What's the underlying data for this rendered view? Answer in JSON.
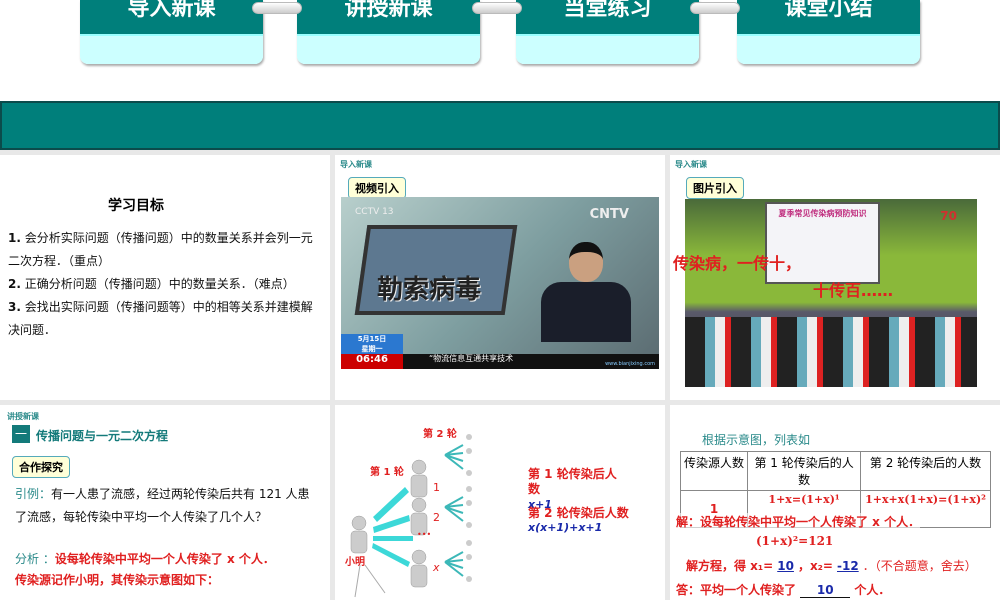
{
  "nav_tabs": [
    "导入新课",
    "讲授新课",
    "当堂练习",
    "课堂小结"
  ],
  "slide1": {
    "title": "学习目标",
    "items": [
      {
        "num": "1.",
        "text": "会分析实际问题（传播问题）中的数量关系并会列一元二次方程．（重点）"
      },
      {
        "num": "2.",
        "text": "正确分析问题（传播问题）中的数量关系．（难点）"
      },
      {
        "num": "3.",
        "text": "会找出实际问题（传播问题等）中的相等关系并建模解决问题．"
      }
    ]
  },
  "slide2": {
    "tag": "导入新课",
    "pill": "视频引入",
    "video": {
      "channel": "CCTV 13",
      "cntv": "CNTV",
      "headline": "勒索病毒",
      "date": "5月15日",
      "weekday": "星期一",
      "time": "06:46",
      "ticker": "“物流信息互通共享技术",
      "site": "www.bianjixing.com"
    }
  },
  "slide3": {
    "tag": "导入新课",
    "pill": "图片引入",
    "screen_title": "夏季常见传染病预防知识",
    "badge": "70",
    "caption1": "传染病，一传十，",
    "caption2": "十传百……"
  },
  "slide4": {
    "tag": "讲授新课",
    "section_num": "一",
    "section_title": "传播问题与一元二次方程",
    "pill": "合作探究",
    "example_label": "引例：",
    "example_text": "有一人患了流感，经过两轮传染后共有 121 人患了流感，每轮传染中平均一个人传染了几个人？",
    "analysis_label": "分析 ：",
    "analysis_text": "设每轮传染中平均一个人传染了 x 个人．",
    "note": "传染源记作小明，其传染示意图如下："
  },
  "slide5": {
    "round2": "第 2 轮",
    "round1": "第 1 轮",
    "labels": [
      "1",
      "2",
      "x"
    ],
    "dots": "•••",
    "source": "小明",
    "after1_label": "第 1 轮传染后人数",
    "after1_value": "x+1",
    "after2_label": "第 2 轮传染后人数",
    "after2_value": "x(x+1)+x+1"
  },
  "slide6": {
    "intro": "根据示意图，列表如下：",
    "headers": [
      "传染源人数",
      "第 1 轮传染后的人数",
      "第 2 轮传染后的人数"
    ],
    "row": [
      "1",
      "1+x=(1+x)¹",
      "1+x+x(1+x)=(1+x)²"
    ],
    "solve": "解：设每轮传染中平均一个人传染了 x 个人．",
    "equation": "(1+x)²=121",
    "roots_prefix": "解方程，得 x₁=",
    "x1": "10",
    "x2_label": "，x₂=",
    "x2": "-12",
    "roots_suffix": "．（不合题意，舍去）",
    "answer_prefix": "答：平均一个人传染了",
    "answer": "10",
    "answer_suffix": "个人．"
  }
}
